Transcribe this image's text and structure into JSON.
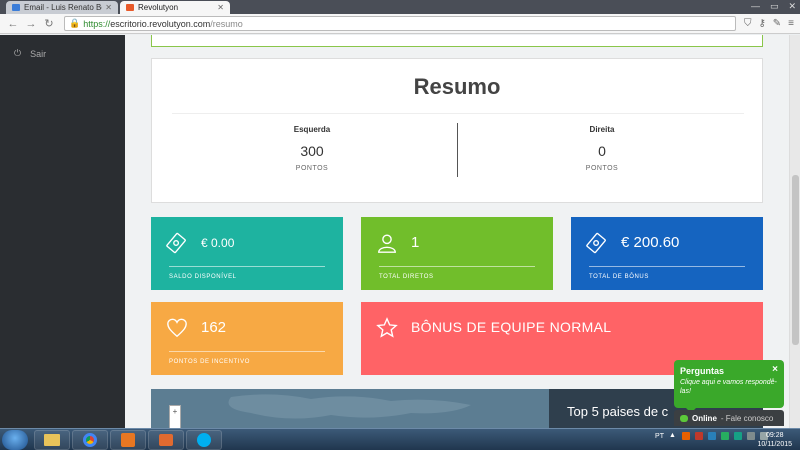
{
  "browser": {
    "tabs": [
      {
        "title": "Email - Luis Renato Botha",
        "active": false
      },
      {
        "title": "Revolutyon",
        "active": true
      }
    ],
    "url": {
      "scheme": "https://",
      "host": "escritorio.revolutyon.com",
      "path": "/resumo"
    }
  },
  "sidebar": {
    "items": [
      {
        "label": "Sair",
        "icon": "power-icon"
      }
    ]
  },
  "resumo": {
    "title": "Resumo",
    "left": {
      "label": "Esquerda",
      "value": "300",
      "unit": "PONTOS"
    },
    "right": {
      "label": "Direita",
      "value": "0",
      "unit": "PONTOS"
    }
  },
  "cards": {
    "saldo": {
      "value": "€ 0.00",
      "label": "SALDO DISPONÍVEL",
      "color": "#1eb3a0",
      "icon": "money-icon"
    },
    "diretos": {
      "value": "1",
      "label": "TOTAL DIRETOS",
      "color": "#71be2b",
      "icon": "user-icon"
    },
    "bonus": {
      "value": "€ 200.60",
      "label": "TOTAL DE BÔNUS",
      "color": "#1564c0",
      "icon": "money-icon"
    },
    "pontos": {
      "value": "162",
      "label": "PONTOS DE INCENTIVO",
      "color": "#f7a944",
      "icon": "heart-icon"
    },
    "equipe": {
      "value": "BÔNUS DE EQUIPE NORMAL",
      "color": "#ff6366",
      "icon": "star-icon"
    }
  },
  "map": {
    "zoom_in": "+"
  },
  "top5": {
    "title": "Top 5 paises de c"
  },
  "chat": {
    "title": "Perguntas",
    "close": "×",
    "message": "Clique aqui e vamos respondê-las!",
    "status": "Online",
    "status_text": "- Fale conosco"
  },
  "taskbar": {
    "lang": "PT",
    "time": "09:28",
    "date": "10/11/2015"
  }
}
